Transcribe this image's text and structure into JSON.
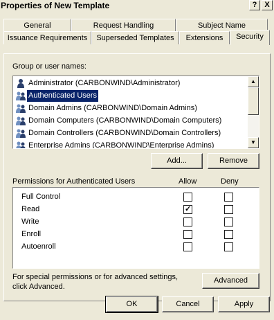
{
  "window": {
    "title": "Properties of New Template",
    "help_label": "?",
    "close_label": "X"
  },
  "tabs": {
    "row1": [
      "General",
      "Request Handling",
      "Subject Name"
    ],
    "row2": [
      "Issuance Requirements",
      "Superseded Templates",
      "Extensions",
      "Security"
    ],
    "active": "Security"
  },
  "group": {
    "label": "Group or user names:",
    "items": [
      {
        "label": "Administrator (CARBONWIND\\Administrator)",
        "icon": "user-icon",
        "selected": false
      },
      {
        "label": "Authenticated Users",
        "icon": "group-icon",
        "selected": true
      },
      {
        "label": "Domain Admins (CARBONWIND\\Domain Admins)",
        "icon": "group-icon",
        "selected": false
      },
      {
        "label": "Domain Computers (CARBONWIND\\Domain Computers)",
        "icon": "group-icon",
        "selected": false
      },
      {
        "label": "Domain Controllers (CARBONWIND\\Domain Controllers)",
        "icon": "group-icon",
        "selected": false
      },
      {
        "label": "Enterprise Admins (CARBONWIND\\Enterprise Admins)",
        "icon": "group-icon",
        "selected": false
      }
    ]
  },
  "buttons": {
    "add": "Add...",
    "remove": "Remove",
    "advanced": "Advanced",
    "ok": "OK",
    "cancel": "Cancel",
    "apply": "Apply"
  },
  "permissions": {
    "label": "Permissions for Authenticated Users",
    "allow_header": "Allow",
    "deny_header": "Deny",
    "rows": [
      {
        "name": "Full Control",
        "allow": false,
        "deny": false
      },
      {
        "name": "Read",
        "allow": true,
        "deny": false
      },
      {
        "name": "Write",
        "allow": false,
        "deny": false
      },
      {
        "name": "Enroll",
        "allow": false,
        "deny": false
      },
      {
        "name": "Autoenroll",
        "allow": false,
        "deny": false
      }
    ]
  },
  "advanced_note": {
    "line1": "For special permissions or for advanced settings,",
    "line2": "click Advanced."
  },
  "colors": {
    "selection": "#0a246a",
    "dialog_bg": "#ece9d8"
  }
}
